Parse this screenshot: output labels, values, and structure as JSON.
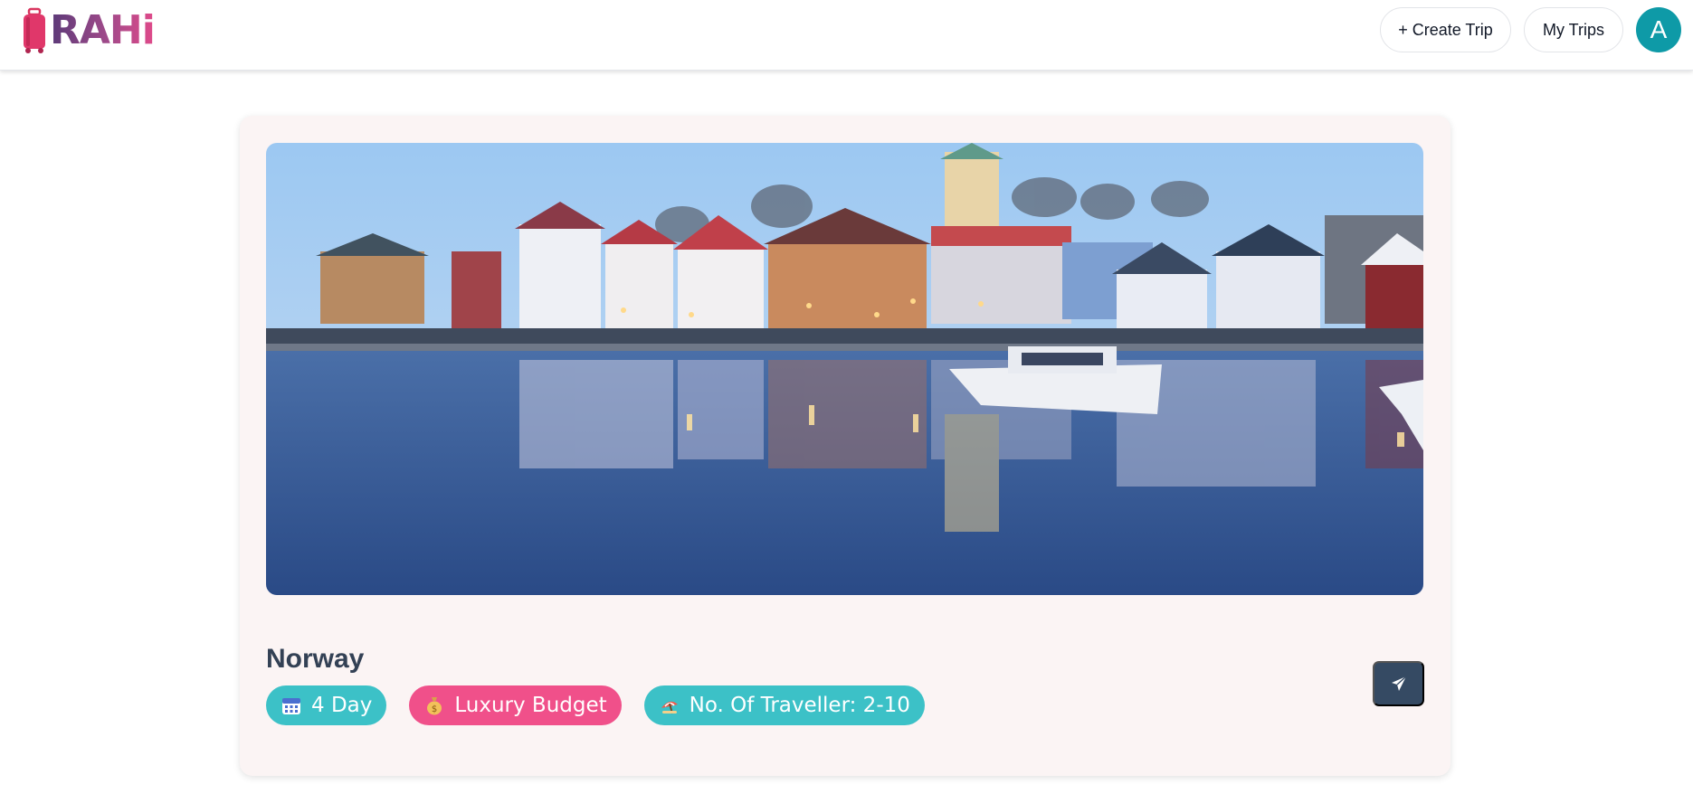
{
  "header": {
    "logo_text": "RAHi",
    "create_trip_label": "+ Create Trip",
    "my_trips_label": "My Trips",
    "avatar_initial": "A"
  },
  "trip": {
    "destination": "Norway",
    "hero_image": "harbor-town-at-dusk",
    "chips": {
      "days": {
        "icon": "calendar-icon",
        "label": "4 Day"
      },
      "budget": {
        "icon": "money-bag-icon",
        "label": "Luxury Budget"
      },
      "travellers": {
        "icon": "travel-icon",
        "label": "No. Of Traveller: 2-10"
      }
    },
    "share_icon": "send-icon"
  },
  "colors": {
    "accent_teal": "#3cc1c7",
    "accent_pink": "#f0508a",
    "avatar_bg": "#0e9aa7",
    "send_button_bg": "#354a63",
    "card_bg": "#fbf4f4",
    "title_color": "#334155"
  }
}
